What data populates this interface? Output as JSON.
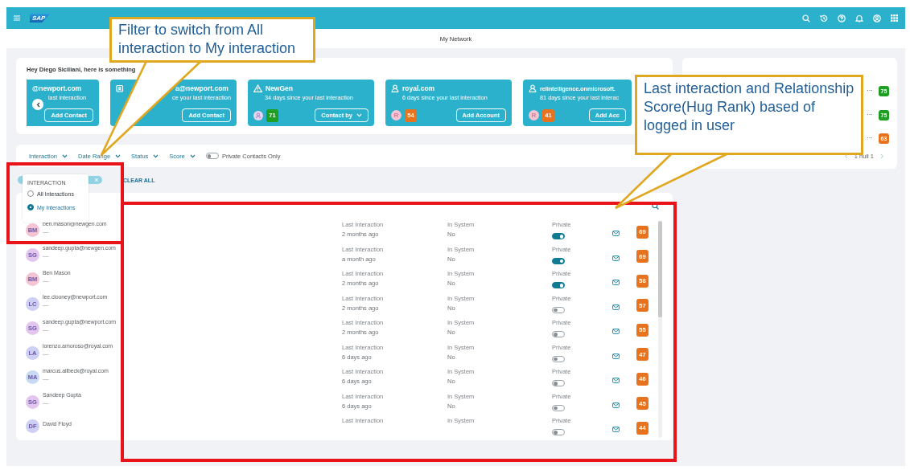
{
  "shellbar": {
    "logo": "SAP"
  },
  "page_title": "My Network",
  "suggestions": {
    "greeting": "Hey Diego Siciliani, here is something",
    "cards": [
      {
        "kind": "cut",
        "title": "@newport.com",
        "subtitle": "last interaction",
        "action": "Add Contact"
      },
      {
        "kind": "contact",
        "title": "a@newport.com",
        "subtitle": "ce your last interaction",
        "action": "Add Contact"
      },
      {
        "kind": "warning",
        "title": "NewGen",
        "subtitle": "34 days since your last interaction",
        "avatar": {
          "kind": "person"
        },
        "score": {
          "value": "71",
          "color": "#1e9e22"
        },
        "action": "Contact by",
        "action_menu": true
      },
      {
        "kind": "person",
        "title": "royal.com",
        "subtitle": "6 days since your last interaction",
        "avatar": {
          "kind": "initials",
          "initials": "R"
        },
        "score": {
          "value": "54",
          "color": "#e8731e"
        },
        "action": "Add Account"
      },
      {
        "kind": "person",
        "title": "relintelligence.onmicrosoft.",
        "subtitle": "81 days since your last interac",
        "avatar": {
          "kind": "initials",
          "initials": "R"
        },
        "score": {
          "value": "41",
          "color": "#e8731e"
        },
        "action": "Add Acc"
      }
    ]
  },
  "private_contacts": {
    "rows": [
      {
        "more": "···",
        "score": {
          "value": "75",
          "color": "#1e9e22"
        }
      },
      {
        "more": "···",
        "score": {
          "value": "75",
          "color": "#1e9e22"
        }
      },
      {
        "more": "···",
        "score": {
          "value": "63",
          "color": "#e8731e"
        }
      }
    ],
    "pagination": "1 null 1"
  },
  "filters": [
    {
      "label": "Interaction"
    },
    {
      "label": "Date Range"
    },
    {
      "label": "Status"
    },
    {
      "label": "Score"
    }
  ],
  "private_only": {
    "label": "Private Contacts Only",
    "on": false
  },
  "clear_all": "CLEAR ALL",
  "dropdown": {
    "title": "INTERACTION",
    "options": [
      {
        "label": "All Interactions",
        "selected": false
      },
      {
        "label": "My Interactions",
        "selected": true
      }
    ]
  },
  "contacts": [
    {
      "initials": "BM",
      "color": "#f2c4d4",
      "name": "ben.mason@newgen.com",
      "sub": "—",
      "last_label": "Last Interaction",
      "last": "2 months ago",
      "system_label": "In System",
      "system": "No",
      "private_label": "Private",
      "private": true,
      "score": {
        "value": "69",
        "color": "#e8731e"
      }
    },
    {
      "initials": "SG",
      "color": "#e3c6ee",
      "name": "sandeep.gupta@newgen.com",
      "sub": "—",
      "last_label": "Last Interaction",
      "last": "a month ago",
      "system_label": "In System",
      "system": "No",
      "private_label": "Private",
      "private": true,
      "score": {
        "value": "69",
        "color": "#e8731e"
      }
    },
    {
      "initials": "BM",
      "color": "#f2c4d4",
      "name": "Ben Mason",
      "sub": "—",
      "last_label": "Last Interaction",
      "last": "2 months ago",
      "system_label": "In System",
      "system": "No",
      "private_label": "Private",
      "private": true,
      "score": {
        "value": "58",
        "color": "#e8731e"
      }
    },
    {
      "initials": "LC",
      "color": "#cdd0f2",
      "name": "lee.clooney@newport.com",
      "sub": "—",
      "last_label": "Last Interaction",
      "last": "2 months ago",
      "system_label": "In System",
      "system": "No",
      "private_label": "Private",
      "private": false,
      "score": {
        "value": "57",
        "color": "#e8731e"
      }
    },
    {
      "initials": "SG",
      "color": "#e3c6ee",
      "name": "sandeep.gupta@newport.com",
      "sub": "—",
      "last_label": "Last Interaction",
      "last": "2 months ago",
      "system_label": "In System",
      "system": "No",
      "private_label": "Private",
      "private": false,
      "score": {
        "value": "55",
        "color": "#e8731e"
      }
    },
    {
      "initials": "LA",
      "color": "#cdd0f2",
      "name": "lorenzo.amoroso@royal.com",
      "sub": "—",
      "last_label": "Last Interaction",
      "last": "6 days ago",
      "system_label": "In System",
      "system": "No",
      "private_label": "Private",
      "private": false,
      "score": {
        "value": "47",
        "color": "#e8731e"
      }
    },
    {
      "initials": "MA",
      "color": "#c8daf3",
      "name": "marcus.allbeck@royal.com",
      "sub": "—",
      "last_label": "Last Interaction",
      "last": "6 days ago",
      "system_label": "In System",
      "system": "No",
      "private_label": "Private",
      "private": false,
      "score": {
        "value": "46",
        "color": "#e8731e"
      }
    },
    {
      "initials": "SG",
      "color": "#e3c6ee",
      "name": "Sandeep Gupta",
      "sub": "—",
      "last_label": "Last Interaction",
      "last": "6 days ago",
      "system_label": "In System",
      "system": "No",
      "private_label": "Private",
      "private": false,
      "score": {
        "value": "45",
        "color": "#e8731e"
      }
    },
    {
      "initials": "DF",
      "color": "#cdd0f2",
      "name": "David Floyd",
      "last_label": "Last Interaction",
      "system_label": "In System",
      "private_label": "Private",
      "private": false,
      "score": {
        "value": "44",
        "color": "#e8731e"
      }
    }
  ],
  "annotations": [
    {
      "text": "Filter to switch from All interaction to My interaction"
    },
    {
      "text": "Last interaction and Relationship Score(Hug Rank) based of logged in user"
    }
  ]
}
